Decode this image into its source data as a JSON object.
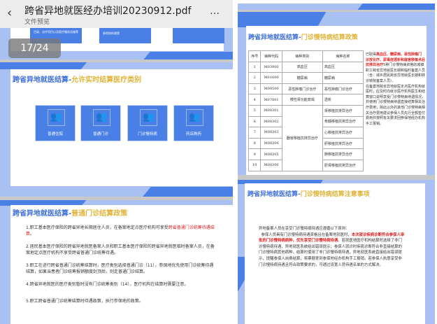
{
  "header": {
    "title": "跨省异地就医经办培训20230912.pdf",
    "subtitle": "文件预览",
    "back_icon": "chevron-left-icon",
    "more_icon": "more-icon"
  },
  "page_indicator": "17/24",
  "prev_slide": {
    "tile1": "目录、诊疗项目以及医疗服务设施等",
    "tile2": "参保地的政策"
  },
  "slide_categories": {
    "title_a": "跨省异地就医结算-",
    "title_b": "允许实时结算医疗类别",
    "tiles": [
      "普通住院",
      "普通门诊",
      "门诊慢特病",
      "药店购药"
    ]
  },
  "slide_outpatient": {
    "title_a": "跨省异地就医结算-",
    "title_b": "普通门诊结算政策",
    "items": [
      {
        "text": "1.职工基本医疗保险的跨省异地长期居住人员，在备案地定点医疗机构可享受",
        "red": "跨省普通门诊统筹待遇结算",
        "tail": "。"
      },
      {
        "text": "2.居民基本医疗保险的跨省异地就医备案人员和职工基本医疗保险的跨省异地就医临时备案人员，在备案地定点医疗机构不享受跨省普通门诊统筹待遇。"
      },
      {
        "text": "3.职工在进行跨省普通门诊统筹结算时，医疗类别选择普通门诊（11），参保地优先使用门诊统筹待遇结算，如果当患者门诊统筹报销额度封顶后，则走普通门诊结算。"
      },
      {
        "text": "4.跨省异地就医的医疗类别暂时没有门诊统筹类别（14），医疗机构在结算时需要注意。"
      },
      {
        "text": "5.职工跨省普通门诊统筹结算时待遇政策，执行参保地的政策。"
      }
    ]
  },
  "slide_chronic": {
    "title_a": "跨省异地就医结算-",
    "title_b": "门诊慢特病结算政策",
    "columns": [
      "序号",
      "病种代码",
      "病种类别",
      "病种名称"
    ],
    "rows": [
      [
        "1",
        "M03900",
        "高血压",
        "高血压"
      ],
      [
        "2",
        "M01600",
        "糖尿病",
        "糖尿病"
      ],
      [
        "3",
        "M00500",
        "恶性肿瘤门诊治疗",
        "恶性肿瘤门诊治疗"
      ],
      [
        "4",
        "M07801",
        "慢性肾功能衰竭",
        "透析"
      ],
      [
        "5",
        "M08301",
        "器官移植抗排异治疗",
        "肾移植抗排异治疗"
      ],
      [
        "6",
        "M08302",
        "",
        "骨髓移植抗排异治疗"
      ],
      [
        "7",
        "M08303",
        "",
        "心移植抗排异治疗"
      ],
      [
        "8",
        "M08304",
        "",
        "肝移植抗排异治疗"
      ],
      [
        "9",
        "M08305",
        "",
        "肺移植抗排异治疗"
      ],
      [
        "10",
        "M08306",
        "",
        "肝肾移植抗排异治疗"
      ]
    ],
    "note_pre": "已取得",
    "note_red": "高血压、糖尿病、恶性肿瘤门诊放化疗、尿毒症透析和器官移植术后抗排异治疗",
    "note_post": "5种门诊慢特病资格的城镇职工跨省异地就医长期和临时备案人员（含：城乡居民跨省异地就医长期和转诊转院备案人员）。",
    "note2": "在备案地跨省异地就医定点医疗机构就医时，应及时向就诊医疗机构医生和结算窗口说明享受门诊慢特病待遇情况，并使用门诊慢特病待遇直接结算相关治疗费用；除此以外的其他门诊慢特病相关治疗费用建议参保人员先行全额垫付费用并按照有关要求回参保地经办机构手工报销。"
  },
  "slide_notes": {
    "title_a": "跨省异地就医结算-",
    "title_b": "门诊慢特病结算注意事项",
    "intro": "异地备案人员在享受门诊慢特病待遇应遵循以下原则：",
    "p_pre": "参保人员具有门诊慢特病待遇资格且在备案地就医时，",
    "p_red": "本次就诊疾病诊断符合参保人审批的门诊慢特病病种，优先享受门诊慢特病待遇",
    "p_post": "。若就医地医疗机构结算时选择了非门诊慢特病待遇，异地就医系统给出错误提示；参保人就诊时疾病诊断符合非直接结算的门诊慢特病其他病种，结算时使用了非门诊慢特病待遇，异地就医系统直接给出错误提示，提醒参保人自费结算，将票据拿到参保地经办机构手工报销。若参保人执意享受非门诊慢特病待遇且符合政策要求的，可通过设置人员待遇名单的方式解决。"
  },
  "colors": {
    "accent": "#4a7fe6",
    "light": "#a8c0f2",
    "title_gold": "#e0b43a",
    "red": "#e02020"
  }
}
